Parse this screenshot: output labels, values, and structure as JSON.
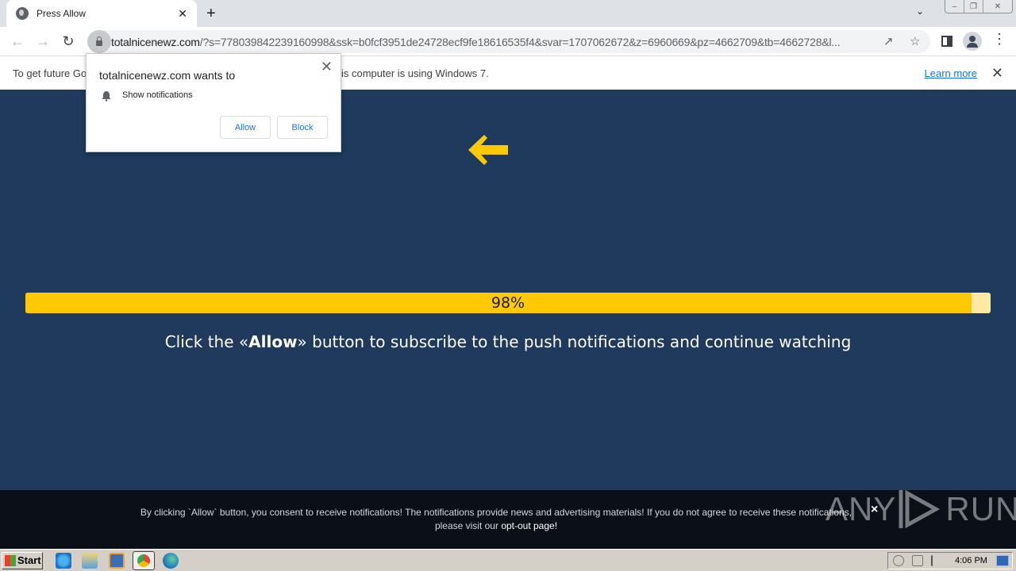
{
  "browser": {
    "tab": {
      "title": "Press Allow",
      "icon": "globe-icon"
    },
    "new_tab_label": "+",
    "url": {
      "domain": "totalnicenewz.com",
      "path": "/?s=778039842239160998&ssk=b0fcf3951de24728ecf9fe18616535f4&svar=1707062672&z=6960669&pz=4662709&tb=4662728&l..."
    },
    "window_controls": {
      "minimize": "–",
      "restore": "❐",
      "close": "✕"
    }
  },
  "infobar": {
    "text": "To get future Google Chrome updates, you'll need Windows 10 or later. This computer is using Windows 7.",
    "visible_left": "To get future Go",
    "visible_right": "is computer is using Windows 7.",
    "learn_more": "Learn more",
    "close": "✕"
  },
  "permission_popup": {
    "title": "totalnicenewz.com wants to",
    "permission": "Show notifications",
    "allow": "Allow",
    "block": "Block",
    "close": "✕"
  },
  "page": {
    "progress": {
      "value_percent": 98,
      "label": "98%"
    },
    "instruction": {
      "prefix": "Click the «",
      "bold": "Allow",
      "suffix": "» button to subscribe to the push notifications and continue watching"
    },
    "colors": {
      "background": "#1f3a5c",
      "accent": "#fdc903",
      "progress_track": "#fde9a2"
    }
  },
  "consent_banner": {
    "line1": "By clicking `Allow` button, you consent to receive notifications! The notifications provide news and advertising materials! If you do not agree to receive these notifications,",
    "line2_prefix": "please visit our ",
    "opt_out_link": "opt-out page!",
    "close": "×",
    "watermark": "ANY RUN"
  },
  "taskbar": {
    "start_label": "Start",
    "pinned": [
      "internet-explorer",
      "file-explorer",
      "media-player",
      "chrome",
      "edge"
    ],
    "clock": "4:06 PM"
  }
}
